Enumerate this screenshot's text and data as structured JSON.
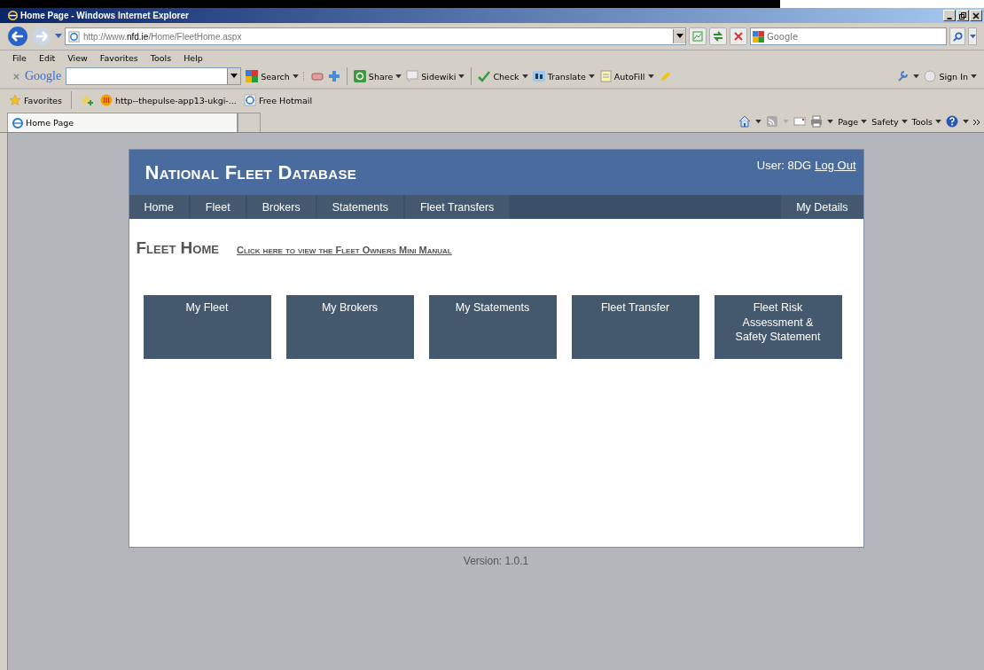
{
  "window": {
    "title": "Home Page - Windows Internet Explorer"
  },
  "address_bar": {
    "url_prefix": "http://www.",
    "url_domain": "nfd.ie",
    "url_path": "/Home/FleetHome.aspx"
  },
  "search_box": {
    "placeholder": "Google"
  },
  "menu": [
    "File",
    "Edit",
    "View",
    "Favorites",
    "Tools",
    "Help"
  ],
  "google_toolbar": {
    "logo": "Google",
    "items": [
      {
        "label": "Search",
        "kind": "search"
      },
      {
        "label": "Share",
        "kind": "share"
      },
      {
        "label": "Sidewiki",
        "kind": "sidewiki"
      },
      {
        "label": "Check",
        "kind": "check"
      },
      {
        "label": "Translate",
        "kind": "translate"
      },
      {
        "label": "AutoFill",
        "kind": "autofill"
      }
    ],
    "sign_in": "Sign In"
  },
  "favorites_bar": {
    "label": "Favorites",
    "items": [
      {
        "label": "http--thepulse-app13-ukgi-...",
        "kind": "site"
      },
      {
        "label": "Free Hotmail",
        "kind": "page"
      }
    ]
  },
  "tabs": [
    {
      "label": "Home Page",
      "selected": true
    }
  ],
  "command_bar": [
    "Page",
    "Safety",
    "Tools"
  ],
  "site": {
    "title": "National Fleet Database",
    "user_label": "User: 8DG",
    "logout": "Log Out",
    "nav": [
      {
        "label": "Home"
      },
      {
        "label": "Fleet"
      },
      {
        "label": "Brokers"
      },
      {
        "label": "Statements"
      },
      {
        "label": "Fleet Transfers"
      }
    ],
    "nav_right": "My Details",
    "heading": "Fleet Home",
    "manual_link": "Click here to view the Fleet Owners Mini Manual",
    "tiles": [
      "My Fleet",
      "My Brokers",
      "My Statements",
      "Fleet Transfer",
      "Fleet Risk Assessment & Safety Statement"
    ],
    "version": "Version: 1.0.1"
  }
}
